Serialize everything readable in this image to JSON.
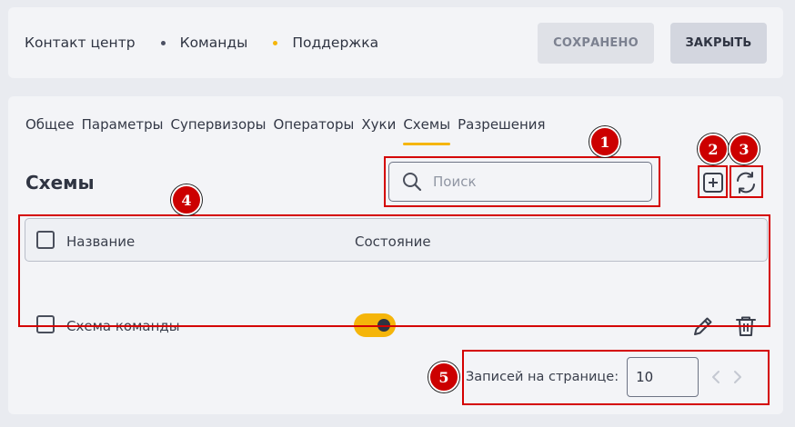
{
  "breadcrumbs": [
    {
      "label": "Контакт центр"
    },
    {
      "label": "Команды",
      "dot_color": "#4b5063"
    },
    {
      "label": "Поддержка",
      "dot_color": "#f5b50a"
    }
  ],
  "header_buttons": {
    "saved_label": "СОХРАНЕНО",
    "close_label": "ЗАКРЫТЬ"
  },
  "tabs": [
    {
      "label": "Общее"
    },
    {
      "label": "Параметры"
    },
    {
      "label": "Супервизоры"
    },
    {
      "label": "Операторы"
    },
    {
      "label": "Хуки"
    },
    {
      "label": "Схемы",
      "active": true
    },
    {
      "label": "Разрешения"
    }
  ],
  "section": {
    "title": "Схемы"
  },
  "search": {
    "placeholder": "Поиск",
    "value": ""
  },
  "actions": {
    "add_icon": "plus-square-icon",
    "refresh_icon": "refresh-icon"
  },
  "table": {
    "columns": [
      "Название",
      "Состояние"
    ],
    "rows": [
      {
        "name": "Схема команды",
        "enabled": true
      }
    ]
  },
  "pagination": {
    "label": "Записей на странице:",
    "page_size": "10"
  },
  "annotations": [
    "1",
    "2",
    "3",
    "4",
    "5"
  ],
  "colors": {
    "accent": "#f5b50a",
    "callout": "#d40000"
  }
}
